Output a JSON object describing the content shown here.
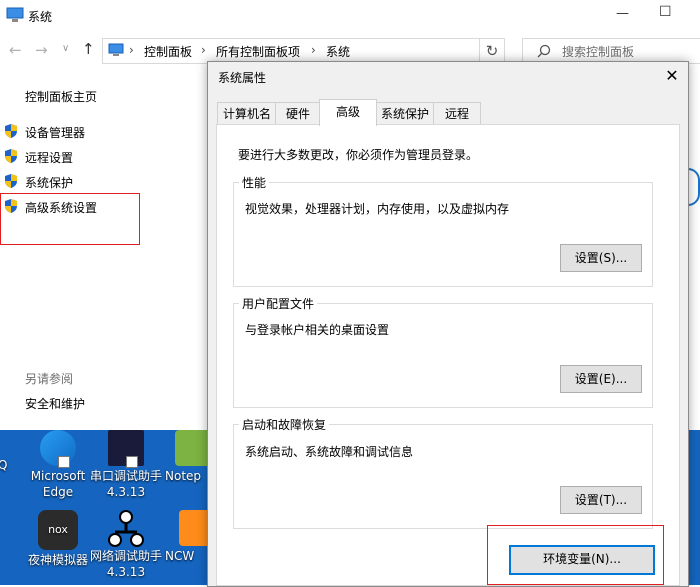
{
  "window": {
    "title": "系统",
    "minimize": "—",
    "maximize": "☐"
  },
  "nav": {
    "back": "←",
    "forward": "→",
    "up": "↑",
    "dropdown": "∨"
  },
  "breadcrumb": {
    "items": [
      "控制面板",
      "所有控制面板项",
      "系统"
    ],
    "sep": "›"
  },
  "search": {
    "placeholder": "搜索控制面板"
  },
  "sidebar": {
    "home": "控制面板主页",
    "links": [
      "设备管理器",
      "远程设置",
      "系统保护",
      "高级系统设置"
    ],
    "see_also_label": "另请参阅",
    "see_also": [
      "安全和维护"
    ]
  },
  "desktop": {
    "icons": [
      {
        "label": "Microsoft Edge"
      },
      {
        "label": "串口调试助手 4.3.13"
      },
      {
        "label": "Notep"
      },
      {
        "label": "夜神模拟器"
      },
      {
        "label": "网络调试助手 4.3.13"
      },
      {
        "label": "NCW"
      }
    ],
    "left_fragment": "Q"
  },
  "dialog": {
    "title": "系统属性",
    "close": "✕",
    "tabs": [
      "计算机名",
      "硬件",
      "高级",
      "系统保护",
      "远程"
    ],
    "active_tab": "高级",
    "notice": "要进行大多数更改，你必须作为管理员登录。",
    "groups": [
      {
        "legend": "性能",
        "desc": "视觉效果，处理器计划，内存使用，以及虚拟内存",
        "button": "设置(S)..."
      },
      {
        "legend": "用户配置文件",
        "desc": "与登录帐户相关的桌面设置",
        "button": "设置(E)..."
      },
      {
        "legend": "启动和故障恢复",
        "desc": "系统启动、系统故障和调试信息",
        "button": "设置(T)..."
      }
    ],
    "env_button": "环境变量(N)..."
  },
  "colors": {
    "highlight_box": "#e02020",
    "primary_border": "#0078d7",
    "desktop_bg": "#1565c0"
  }
}
